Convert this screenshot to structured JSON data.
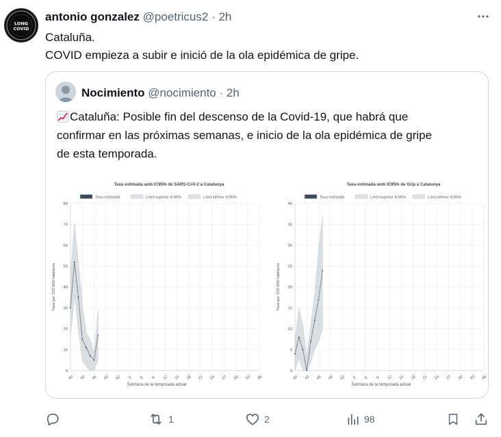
{
  "author": {
    "name": "antonio gonzalez",
    "handle": "@poetricus2",
    "separator": "·",
    "time": "2h",
    "avatar_top_text": "LONG COVID",
    "avatar_ring_text": "LONG COVID"
  },
  "tweet": {
    "lines": [
      "Cataluña.",
      "COVID empieza a subir e inició de la ola epidémica de gripe."
    ]
  },
  "quote": {
    "name": "Nocimiento",
    "handle": "@nocimiento",
    "separator": "·",
    "time": "2h",
    "lines": [
      "Cataluña: Posible fin del descenso de la Covid-19, que habrá que",
      "confirmar en las próximas semanas, e inicio de la ola epidémica de gripe",
      "de esta temporada."
    ]
  },
  "actions": {
    "reply_count": "",
    "retweet_count": "1",
    "like_count": "2",
    "views_count": "98"
  },
  "colors": {
    "text": "#0f1419",
    "muted": "#536471",
    "border": "#cfd9de",
    "line": "#3b4a5e",
    "band": "#dde2e7"
  },
  "chart_data": [
    {
      "type": "line",
      "title": "Taxa estimada amb IC95% de SARS-CoV-2 a Catalunya",
      "xlabel": "Setmana de la temporada actual",
      "ylabel": "Taxa per 100 000 habitants",
      "x_ticks": [
        "40",
        "43",
        "46",
        "49",
        "52",
        "3",
        "6",
        "9",
        "12",
        "15",
        "18",
        "21",
        "24",
        "27",
        "30",
        "33",
        "36"
      ],
      "ylim": [
        0,
        80
      ],
      "y_ticks": [
        0,
        10,
        20,
        30,
        40,
        50,
        60,
        70,
        80
      ],
      "legend": [
        "Taxa estimada",
        "Límit superior IC95%",
        "Límit inferior IC95%"
      ],
      "legend_position": "top",
      "grid": true,
      "series": [
        {
          "name": "Taxa estimada",
          "x": [
            40,
            41,
            42,
            43,
            44,
            45,
            46,
            47
          ],
          "values": [
            30,
            52,
            35,
            15,
            11,
            7,
            5,
            17
          ]
        },
        {
          "name": "Límit superior IC95%",
          "x": [
            40,
            41,
            42,
            43,
            44,
            45,
            46,
            47
          ],
          "values": [
            45,
            71,
            52,
            32,
            18,
            15,
            8,
            29
          ]
        },
        {
          "name": "Límit inferior IC95%",
          "x": [
            40,
            41,
            42,
            43,
            44,
            45,
            46,
            47
          ],
          "values": [
            16,
            36,
            20,
            5,
            2,
            0,
            0,
            5
          ]
        }
      ]
    },
    {
      "type": "line",
      "title": "Taxa estimada amb IC95% de Grip a Catalunya",
      "xlabel": "Setmana de la temporada actual",
      "ylabel": "Taxa per 100 000 habitants",
      "x_ticks": [
        "40",
        "43",
        "46",
        "49",
        "52",
        "3",
        "6",
        "9",
        "12",
        "15",
        "18",
        "21",
        "24",
        "27",
        "30",
        "33",
        "36"
      ],
      "ylim": [
        0,
        40
      ],
      "y_ticks": [
        0,
        5,
        10,
        15,
        20,
        25,
        30,
        35,
        40
      ],
      "legend": [
        "Taxa estimada",
        "Límit superior IC95%",
        "Límit inferior IC95%"
      ],
      "legend_position": "top",
      "grid": true,
      "series": [
        {
          "name": "Taxa estimada",
          "x": [
            40,
            41,
            42,
            43,
            44,
            45,
            46,
            47
          ],
          "values": [
            4,
            8,
            5,
            0,
            7,
            12,
            17,
            24
          ]
        },
        {
          "name": "Límit superior IC95%",
          "x": [
            40,
            41,
            42,
            43,
            44,
            45,
            46,
            47
          ],
          "values": [
            7,
            15,
            11,
            3,
            11,
            18,
            29,
            37
          ]
        },
        {
          "name": "Límit inferior IC95%",
          "x": [
            40,
            41,
            42,
            43,
            44,
            45,
            46,
            47
          ],
          "values": [
            0,
            3,
            0,
            0,
            2,
            5,
            7,
            10
          ]
        }
      ]
    }
  ]
}
